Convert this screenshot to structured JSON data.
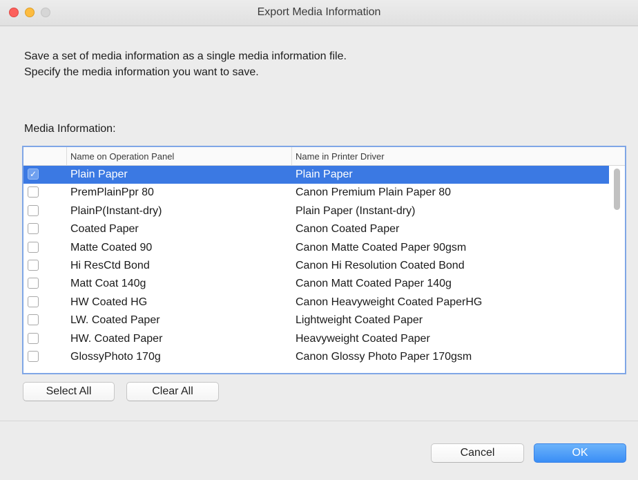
{
  "window": {
    "title": "Export Media Information"
  },
  "description": {
    "line1": "Save a set of media information as a single media information file.",
    "line2": "Specify the media information you want to save."
  },
  "media_label": "Media Information:",
  "table": {
    "columns": [
      "",
      "Name on Operation Panel",
      "Name in Printer Driver"
    ],
    "rows": [
      {
        "checked": true,
        "panel": "Plain Paper",
        "driver": "Plain Paper",
        "check_mark": "✓"
      },
      {
        "checked": false,
        "panel": "PremPlainPpr 80",
        "driver": "Canon Premium Plain Paper 80"
      },
      {
        "checked": false,
        "panel": "PlainP(Instant-dry)",
        "driver": "Plain Paper (Instant-dry)"
      },
      {
        "checked": false,
        "panel": "Coated Paper",
        "driver": "Canon Coated Paper"
      },
      {
        "checked": false,
        "panel": "Matte Coated 90",
        "driver": "Canon Matte Coated Paper 90gsm"
      },
      {
        "checked": false,
        "panel": "Hi ResCtd Bond",
        "driver": "Canon Hi Resolution Coated Bond"
      },
      {
        "checked": false,
        "panel": "Matt Coat 140g",
        "driver": "Canon Matt Coated Paper 140g"
      },
      {
        "checked": false,
        "panel": "HW Coated HG",
        "driver": "Canon Heavyweight Coated PaperHG"
      },
      {
        "checked": false,
        "panel": "LW. Coated Paper",
        "driver": "Lightweight Coated Paper"
      },
      {
        "checked": false,
        "panel": "HW. Coated Paper",
        "driver": "Heavyweight Coated Paper"
      },
      {
        "checked": false,
        "panel": "GlossyPhoto 170g",
        "driver": "Canon Glossy Photo Paper 170gsm"
      }
    ]
  },
  "buttons": {
    "select_all": "Select All",
    "clear_all": "Clear All",
    "cancel": "Cancel",
    "ok": "OK"
  },
  "colors": {
    "selection": "#3b79e3",
    "ok_button": "#3a8ef6",
    "close_light": "#fc605c",
    "minimize_light": "#fdbc40"
  }
}
